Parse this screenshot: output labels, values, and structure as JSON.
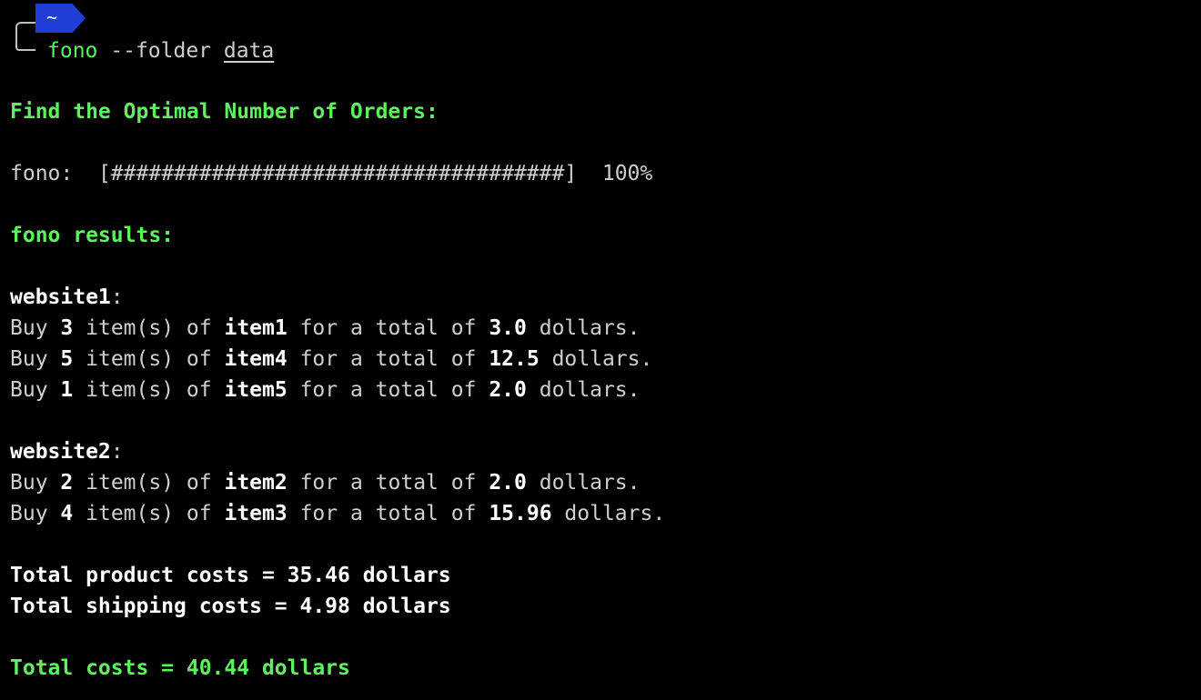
{
  "prompt": {
    "badge": "~",
    "command": "fono",
    "flag": "--folder",
    "arg": "data"
  },
  "heading": "Find the Optimal Number of Orders:",
  "progress": {
    "label": "fono:",
    "bar": "[####################################]",
    "percent": "100%",
    "value": 1.0
  },
  "results_heading": "fono results:",
  "websites": [
    {
      "name": "website1",
      "orders": [
        {
          "qty": "3",
          "item": "item1",
          "total": "3.0"
        },
        {
          "qty": "5",
          "item": "item4",
          "total": "12.5"
        },
        {
          "qty": "1",
          "item": "item5",
          "total": "2.0"
        }
      ]
    },
    {
      "name": "website2",
      "orders": [
        {
          "qty": "2",
          "item": "item2",
          "total": "2.0"
        },
        {
          "qty": "4",
          "item": "item3",
          "total": "15.96"
        }
      ]
    }
  ],
  "text": {
    "buy": "Buy",
    "items_of": "item(s) of",
    "for_total": "for a total of",
    "dollars_dot": "dollars.",
    "colon": ":"
  },
  "totals": {
    "product": "Total product costs = 35.46 dollars",
    "shipping": "Total shipping costs = 4.98 dollars",
    "overall": "Total costs = 40.44 dollars"
  },
  "colors": {
    "background": "#000000",
    "text": "#cfcfcf",
    "green": "#5ff25f",
    "badge": "#1f3fd6"
  }
}
